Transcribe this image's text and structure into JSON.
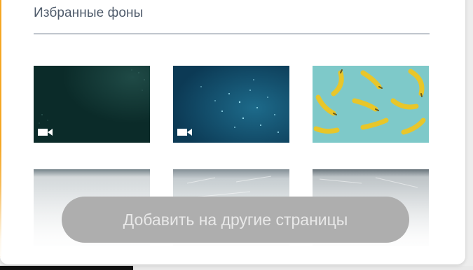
{
  "favorites": {
    "title": "Избранные фоны",
    "backgrounds": [
      {
        "name": "dark-teal",
        "is_video": true
      },
      {
        "name": "blue-particles",
        "is_video": true
      },
      {
        "name": "bananas",
        "is_video": false
      },
      {
        "name": "grey-texture-1",
        "is_video": false
      },
      {
        "name": "grey-texture-2",
        "is_video": false
      },
      {
        "name": "grey-texture-3",
        "is_video": false
      }
    ]
  },
  "actions": {
    "add_to_pages_label": "Добавить на другие страницы"
  },
  "colors": {
    "accent": "#f5a623",
    "title_text": "#4f5b6b",
    "button_bg": "#aeaeae",
    "button_text": "#e8e8e8"
  }
}
